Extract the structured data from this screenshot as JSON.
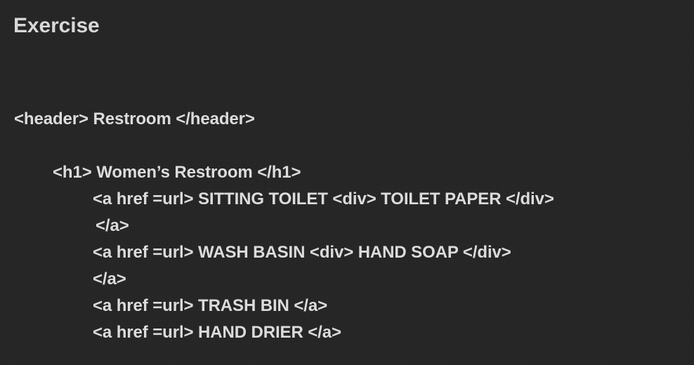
{
  "title": "Exercise",
  "lines": [
    "<header> Restroom </header>",
    "<h1> Women’s Restroom </h1>",
    "<a href =url> SITTING TOILET <div> TOILET PAPER </div>",
    "</a>",
    "<a href =url> WASH BASIN <div> HAND SOAP </div>",
    "</a>",
    "<a href =url> TRASH BIN </a>",
    "<a href =url> HAND DRIER </a>"
  ]
}
